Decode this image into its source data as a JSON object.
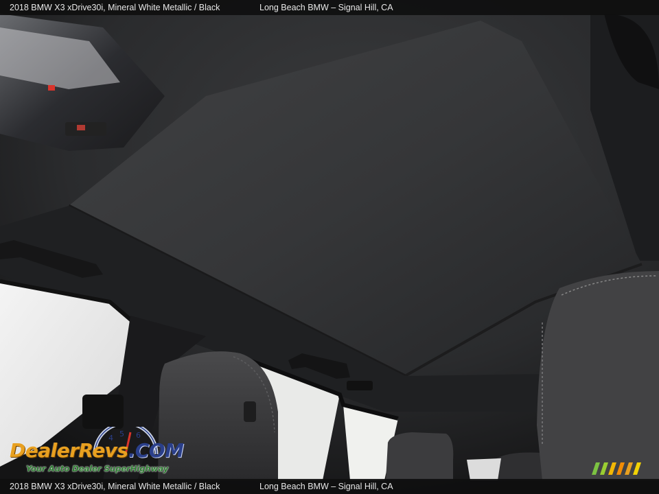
{
  "caption": {
    "model": "2018 BMW X3 xDrive30i,  Mineral White Metallic / Black",
    "dealer": "Long Beach BMW – Signal Hill, CA"
  },
  "watermark": {
    "brand": "DealerRevs",
    "suffix": ".COM",
    "slogan": "Your Auto Dealer SuperHighway"
  },
  "colors": {
    "headliner": "#2b2c2e",
    "brand_orange": "#e8a020",
    "brand_blue": "#2a3f8a",
    "slogan_green": "#2e7d32"
  }
}
